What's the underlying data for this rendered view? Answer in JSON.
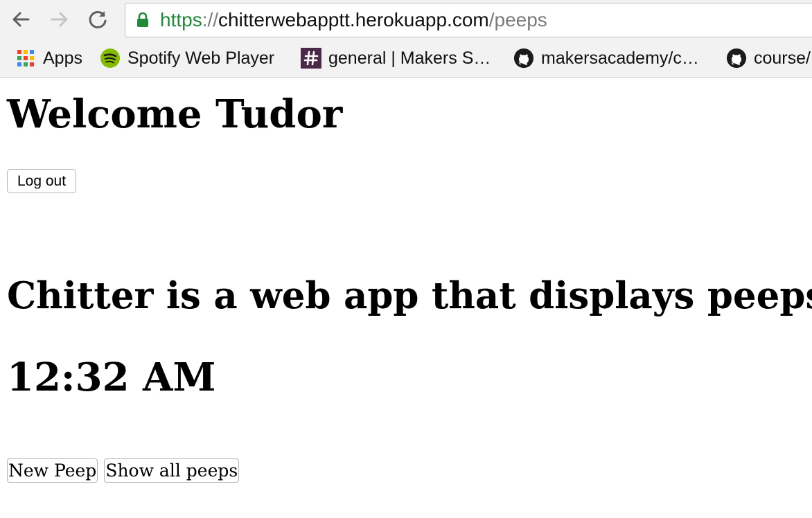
{
  "browser": {
    "url": {
      "scheme": "https",
      "separator": "://",
      "host": "chitterwebapptt.herokuapp.com",
      "path": "/peeps"
    },
    "bookmarks": [
      {
        "label": "Apps",
        "icon": "apps-grid-icon"
      },
      {
        "label": "Spotify Web Player",
        "icon": "spotify-icon"
      },
      {
        "label": "general | Makers S…",
        "icon": "slack-hash-icon"
      },
      {
        "label": "makersacademy/c…",
        "icon": "github-icon"
      },
      {
        "label": "course/",
        "icon": "github-icon"
      }
    ],
    "colors": {
      "secure_green": "#1e8b3a",
      "spotify_green": "#84bd00",
      "slack_purple": "#4a2a48"
    }
  },
  "page": {
    "welcome": "Welcome Tudor",
    "logout_label": "Log out",
    "tagline": "Chitter is a web app that displays peeps.",
    "time": "12:32 AM",
    "new_peep_label": "New Peep",
    "show_all_label": "Show all peeps"
  }
}
